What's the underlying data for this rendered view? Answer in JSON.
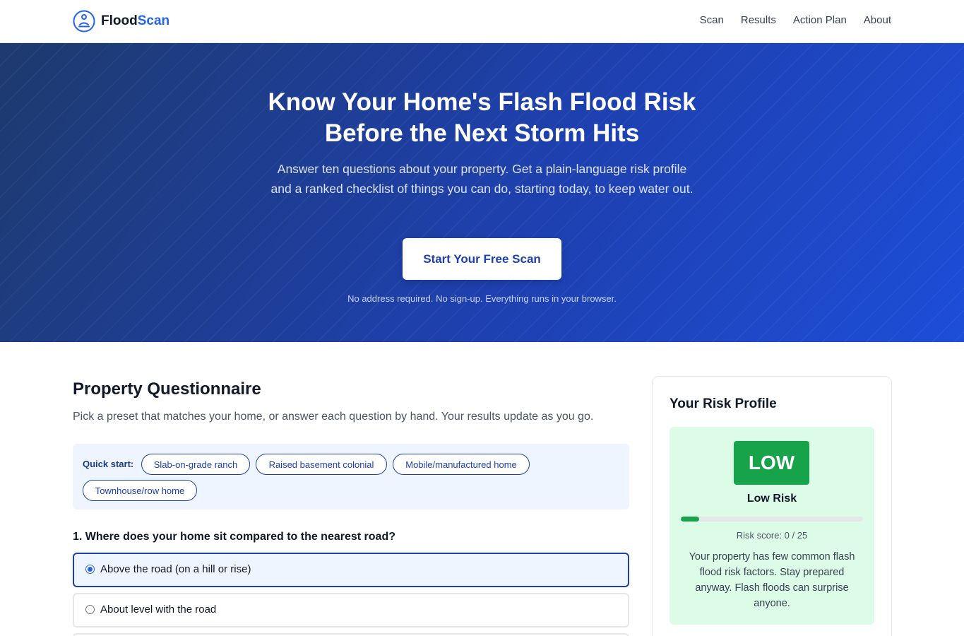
{
  "header": {
    "brand_primary": "Flood",
    "brand_accent": "Scan",
    "logo_icon": "person-in-circle-icon",
    "nav": [
      "Scan",
      "Results",
      "Action Plan",
      "About"
    ]
  },
  "hero": {
    "title_line1": "Know Your Home's Flash Flood Risk",
    "title_line2": "Before the Next Storm Hits",
    "subtitle": "Answer ten questions about your property. Get a plain-language risk profile and a ranked checklist of things you can do, starting today, to keep water out.",
    "cta_label": "Start Your Free Scan",
    "note": "No address required. No sign-up. Everything runs in your browser."
  },
  "questionnaire": {
    "title": "Property Questionnaire",
    "intro": "Pick a preset that matches your home, or answer each question by hand. Your results update as you go.",
    "quick_start_label": "Quick start:",
    "presets": [
      "Slab-on-grade ranch",
      "Raised basement colonial",
      "Mobile/manufactured home",
      "Townhouse/row home"
    ],
    "question1": {
      "text": "1. Where does your home sit compared to the nearest road?",
      "options": [
        "Above the road (on a hill or rise)",
        "About level with the road"
      ],
      "selected_index": 0
    }
  },
  "risk_profile": {
    "title": "Your Risk Profile",
    "badge": "LOW",
    "label": "Low Risk",
    "score_text": "Risk score: 0 / 25",
    "score_fraction": 0.1,
    "description": "Your property has few common flash flood risk factors. Stay prepared anyway. Flash floods can surprise anyone.",
    "color": "#16a34a",
    "background": "#dcfce7"
  },
  "colors": {
    "brand_blue": "#2563eb",
    "hero_dark": "#1e3a6e",
    "hero_bright": "#1d4ed8"
  }
}
